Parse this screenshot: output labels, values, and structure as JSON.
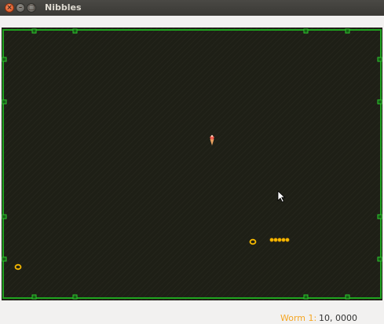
{
  "window": {
    "title": "Nibbles",
    "buttons": [
      {
        "name": "close",
        "glyph": "×"
      },
      {
        "name": "minimize",
        "glyph": "–"
      },
      {
        "name": "maximize",
        "glyph": "▢"
      }
    ]
  },
  "board": {
    "background_color": "#1e1f16",
    "wall_color": "#1fa31f",
    "worm_color": "#f5b800",
    "bonus_ring_color": "#f5b800"
  },
  "sprites": {
    "worm_segments": 5,
    "bonus_items": [
      {
        "type": "ring"
      },
      {
        "type": "ring"
      },
      {
        "type": "ice-cream"
      }
    ]
  },
  "status": {
    "worm_label": "Worm 1:",
    "worm_score": "10, 0000",
    "worm_label_color": "#f5a623"
  }
}
